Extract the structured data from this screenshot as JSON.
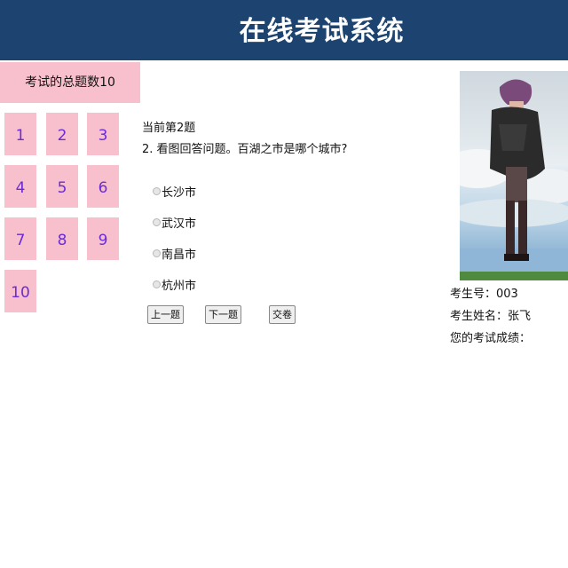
{
  "header": {
    "title": "在线考试系统"
  },
  "sidebar": {
    "total_label": "考试的总题数10",
    "questions": [
      "1",
      "2",
      "3",
      "4",
      "5",
      "6",
      "7",
      "8",
      "9",
      "10"
    ]
  },
  "main": {
    "current_label": "当前第2题",
    "question_text": "2. 看图回答问题。百湖之市是哪个城市?",
    "options": [
      "长沙市",
      "武汉市",
      "南昌市",
      "杭州市"
    ],
    "buttons": {
      "prev": "上一题",
      "next": "下一题",
      "submit": "交卷"
    }
  },
  "student": {
    "id_label": "考生号：003",
    "name_label": "考生姓名：张飞",
    "score_label": "您的考试成绩："
  },
  "colors": {
    "header": "#1d4470",
    "pink": "#f8c0cc",
    "number": "#6a2bd8"
  }
}
